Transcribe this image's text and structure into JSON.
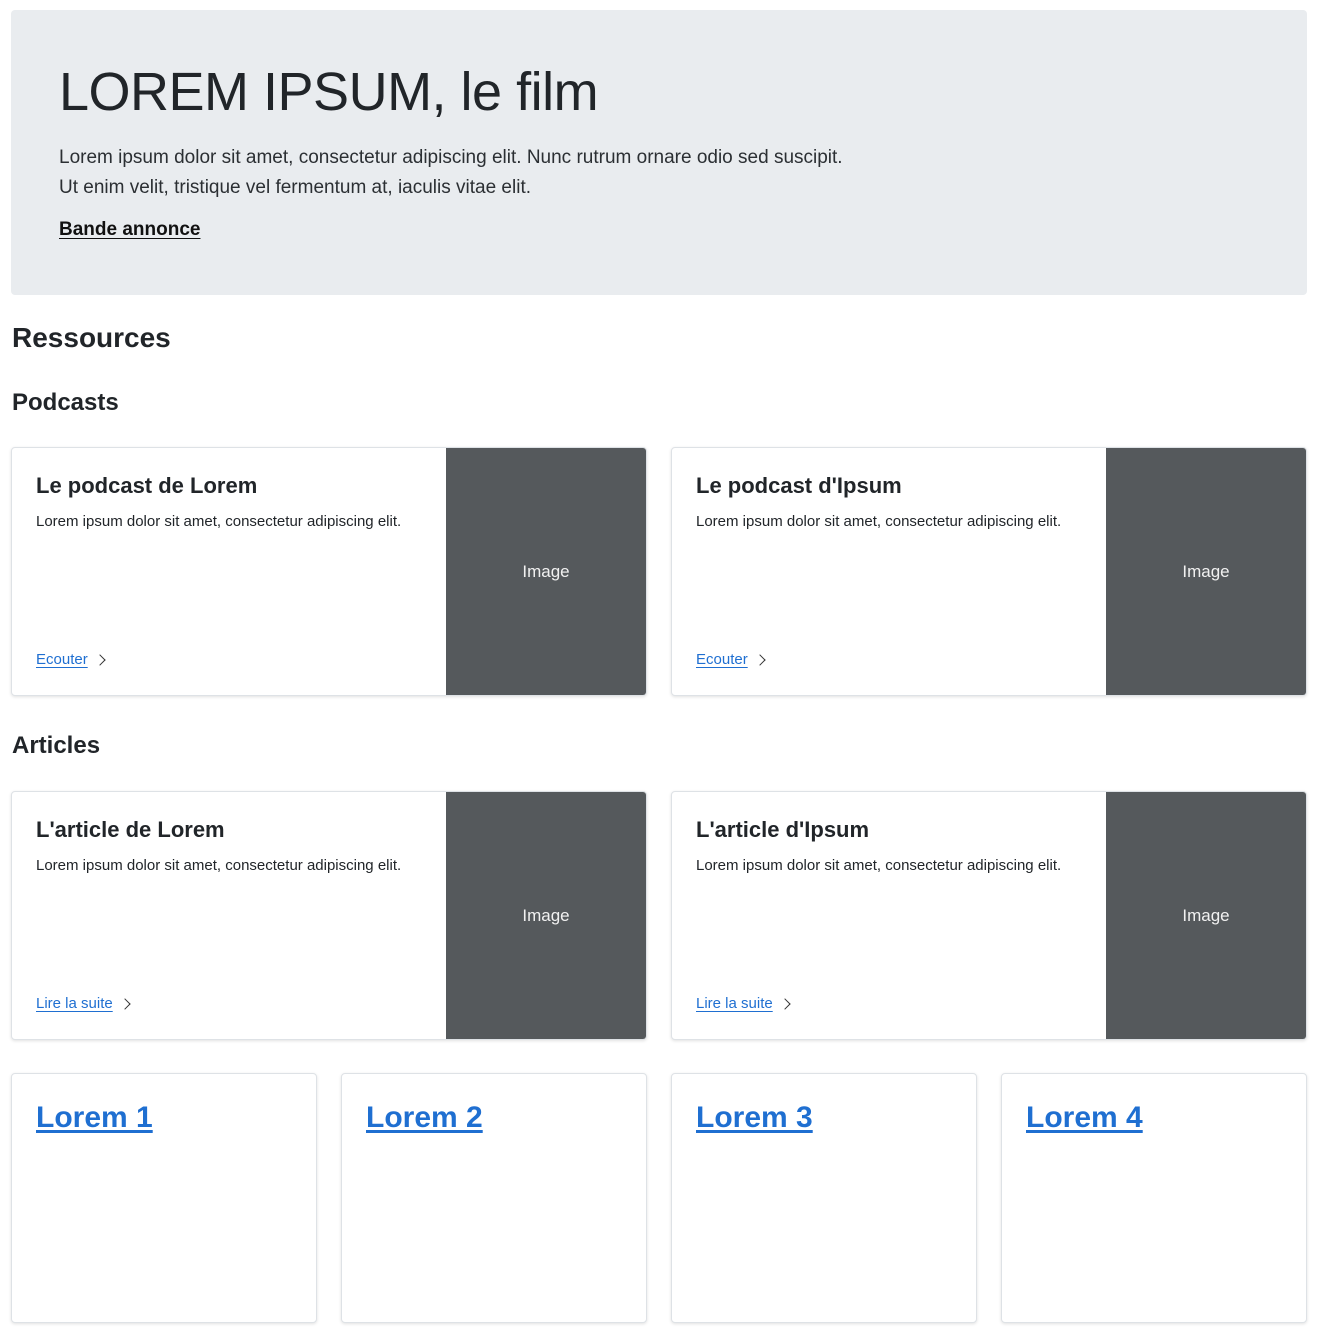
{
  "hero": {
    "title": "LOREM IPSUM, le film",
    "lead_line1": "Lorem ipsum dolor sit amet, consectetur adipiscing elit. Nunc rutrum ornare odio sed suscipit.",
    "lead_line2": "Ut enim velit, tristique vel fermentum at, iaculis vitae elit.",
    "link_label": "Bande annonce"
  },
  "resources": {
    "heading": "Ressources",
    "podcasts": {
      "heading": "Podcasts",
      "items": [
        {
          "title": "Le podcast de Lorem",
          "text": "Lorem ipsum dolor sit amet, consectetur adipiscing elit.",
          "link_label": "Ecouter",
          "image_label": "Image"
        },
        {
          "title": "Le podcast d'Ipsum",
          "text": "Lorem ipsum dolor sit amet, consectetur adipiscing elit.",
          "link_label": "Ecouter",
          "image_label": "Image"
        }
      ]
    },
    "articles": {
      "heading": "Articles",
      "items": [
        {
          "title": "L'article de Lorem",
          "text": "Lorem ipsum dolor sit amet, consectetur adipiscing elit.",
          "link_label": "Lire la suite",
          "image_label": "Image"
        },
        {
          "title": "L'article d'Ipsum",
          "text": "Lorem ipsum dolor sit amet, consectetur adipiscing elit.",
          "link_label": "Lire la suite",
          "image_label": "Image"
        }
      ]
    },
    "tiles": [
      {
        "label": "Lorem 1"
      },
      {
        "label": "Lorem 2"
      },
      {
        "label": "Lorem 3"
      },
      {
        "label": "Lorem 4"
      }
    ]
  },
  "colors": {
    "hero_bg": "#e9ecef",
    "link_blue": "#1f6fd1",
    "image_placeholder": "#55595c"
  },
  "icons": {
    "link_arrow": "chevron-right-icon"
  }
}
